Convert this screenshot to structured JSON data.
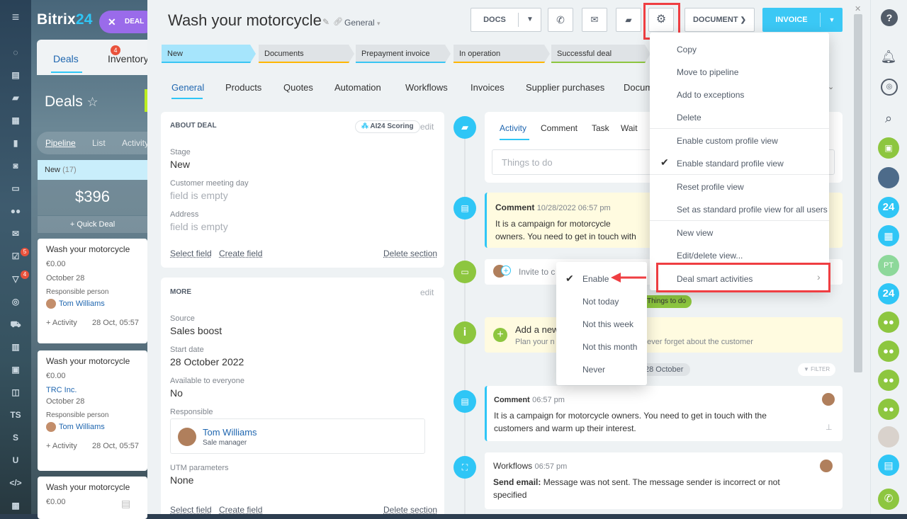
{
  "leftnav": {
    "badge1": "5",
    "badge2": "4",
    "ts": "TS",
    "s": "S",
    "u": "U"
  },
  "bg": {
    "logo_main": "Bitrix",
    "logo_num": "24",
    "deal_button": "DEAL",
    "tab_deals": "Deals",
    "tab_deals_badge": "4",
    "tab_inventory": "Inventory",
    "page_title": "Deals",
    "view_pipeline": "Pipeline",
    "view_list": "List",
    "view_activity": "Activity",
    "column_title": "New",
    "column_count": "(17)",
    "column_sum": "$396",
    "quick_deal": "+ Quick Deal",
    "cards": [
      {
        "title": "Wash your motorcycle",
        "amount": "€0.00",
        "date": "October 28",
        "resp_label": "Responsible person",
        "person": "Tom Williams",
        "activity": "+ Activity",
        "time": "28 Oct, 05:57"
      },
      {
        "title": "Wash your motorcycle",
        "amount": "€0.00",
        "company": "TRC Inc.",
        "date": "October 28",
        "resp_label": "Responsible person",
        "person": "Tom Williams",
        "activity": "+ Activity",
        "time": "28 Oct, 05:57"
      },
      {
        "title": "Wash your motorcycle",
        "amount": "€0.00"
      }
    ]
  },
  "deal": {
    "title": "Wash your motorcycle",
    "category": "General",
    "buttons": {
      "docs": "DOCS",
      "document": "DOCUMENT",
      "invoice": "INVOICE"
    },
    "stages": [
      {
        "label": "New",
        "color": "#a6e5fc",
        "line": "#39c5f3"
      },
      {
        "label": "Documents",
        "color": "#dfe3e6",
        "line": "#ffb600"
      },
      {
        "label": "Prepayment invoice",
        "color": "#dfe3e6",
        "line": "#39c5f3"
      },
      {
        "label": "In operation",
        "color": "#dfe3e6",
        "line": "#ffb600"
      },
      {
        "label": "Successful deal",
        "color": "#dfe3e6",
        "line": "#8dc63f"
      }
    ],
    "tabs": [
      "General",
      "Products",
      "Quotes",
      "Automation",
      "Workflows",
      "Invoices",
      "Supplier purchases",
      "Documents"
    ]
  },
  "about": {
    "title": "ABOUT DEAL",
    "scoring": "AI24 Scoring",
    "edit": "edit",
    "fields": [
      {
        "label": "Stage",
        "value": "New"
      },
      {
        "label": "Customer meeting day",
        "value": "field is empty"
      },
      {
        "label": "Address",
        "value": "field is empty"
      }
    ],
    "select_field": "Select field",
    "create_field": "Create field",
    "delete_section": "Delete section"
  },
  "more": {
    "title": "MORE",
    "edit": "edit",
    "fields": [
      {
        "label": "Source",
        "value": "Sales boost"
      },
      {
        "label": "Start date",
        "value": "28 October 2022"
      },
      {
        "label": "Available to everyone",
        "value": "No"
      }
    ],
    "resp_label": "Responsible",
    "resp_name": "Tom Williams",
    "resp_role": "Sale manager",
    "utm_label": "UTM parameters",
    "utm_value": "None",
    "select_field": "Select field",
    "create_field": "Create field",
    "delete_section": "Delete section"
  },
  "timeline": {
    "tabs": [
      "Activity",
      "Comment",
      "Task",
      "Wait"
    ],
    "todo_placeholder": "Things to do",
    "comment1": {
      "title": "Comment",
      "time": "10/28/2022 06:57 pm",
      "text": "It is a campaign for motorcycle owners. You need to get in touch with the customers and warm up their interest."
    },
    "invite": "Invite to c",
    "things_badge": "Things to do",
    "add_title": "Add a new",
    "add_sub": "Plan your n",
    "add_tail": "never forget about the customer",
    "date_badge": "28 October",
    "filter": "FILTER",
    "comment2": {
      "title": "Comment",
      "time": "06:57 pm",
      "line1": "It is a campaign for motorcycle owners. You need to get in touch with the",
      "line2": "customers and warm up their interest."
    },
    "workflow": {
      "title": "Workflows",
      "time": "06:57 pm",
      "label": "Send email:",
      "line1": "Message was not sent. The message sender is incorrect or not",
      "line2": "specified"
    }
  },
  "menu": {
    "items": [
      "Copy",
      "Move to pipeline",
      "Add to exceptions",
      "Delete",
      "Enable custom profile view",
      "Enable standard profile view",
      "Reset profile view",
      "Set as standard profile view for all users",
      "New view",
      "Edit/delete view...",
      "Deal smart activities"
    ],
    "chevron": "›"
  },
  "submenu": {
    "items": [
      "Enable",
      "Not today",
      "Not this week",
      "Not this month",
      "Never"
    ]
  },
  "rightbar": {
    "avatar_pt": "PT",
    "b24": "24"
  },
  "colors": {
    "accent": "#2fc6f6",
    "highlight": "#ef3e42",
    "purple": "#9a6bea",
    "green": "#8dc63f"
  }
}
